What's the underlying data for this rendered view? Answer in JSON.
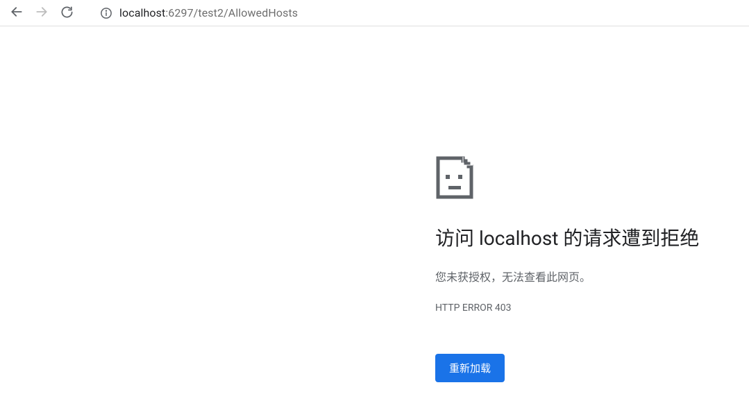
{
  "toolbar": {
    "url_host": "localhost",
    "url_rest": ":6297/test2/AllowedHosts"
  },
  "error": {
    "title_pre": "访问 ",
    "title_host": "localhost",
    "title_post": " 的请求遭到拒绝",
    "subtitle": "您未获授权，无法查看此网页。",
    "code": "HTTP ERROR 403",
    "reload_label": "重新加载"
  }
}
